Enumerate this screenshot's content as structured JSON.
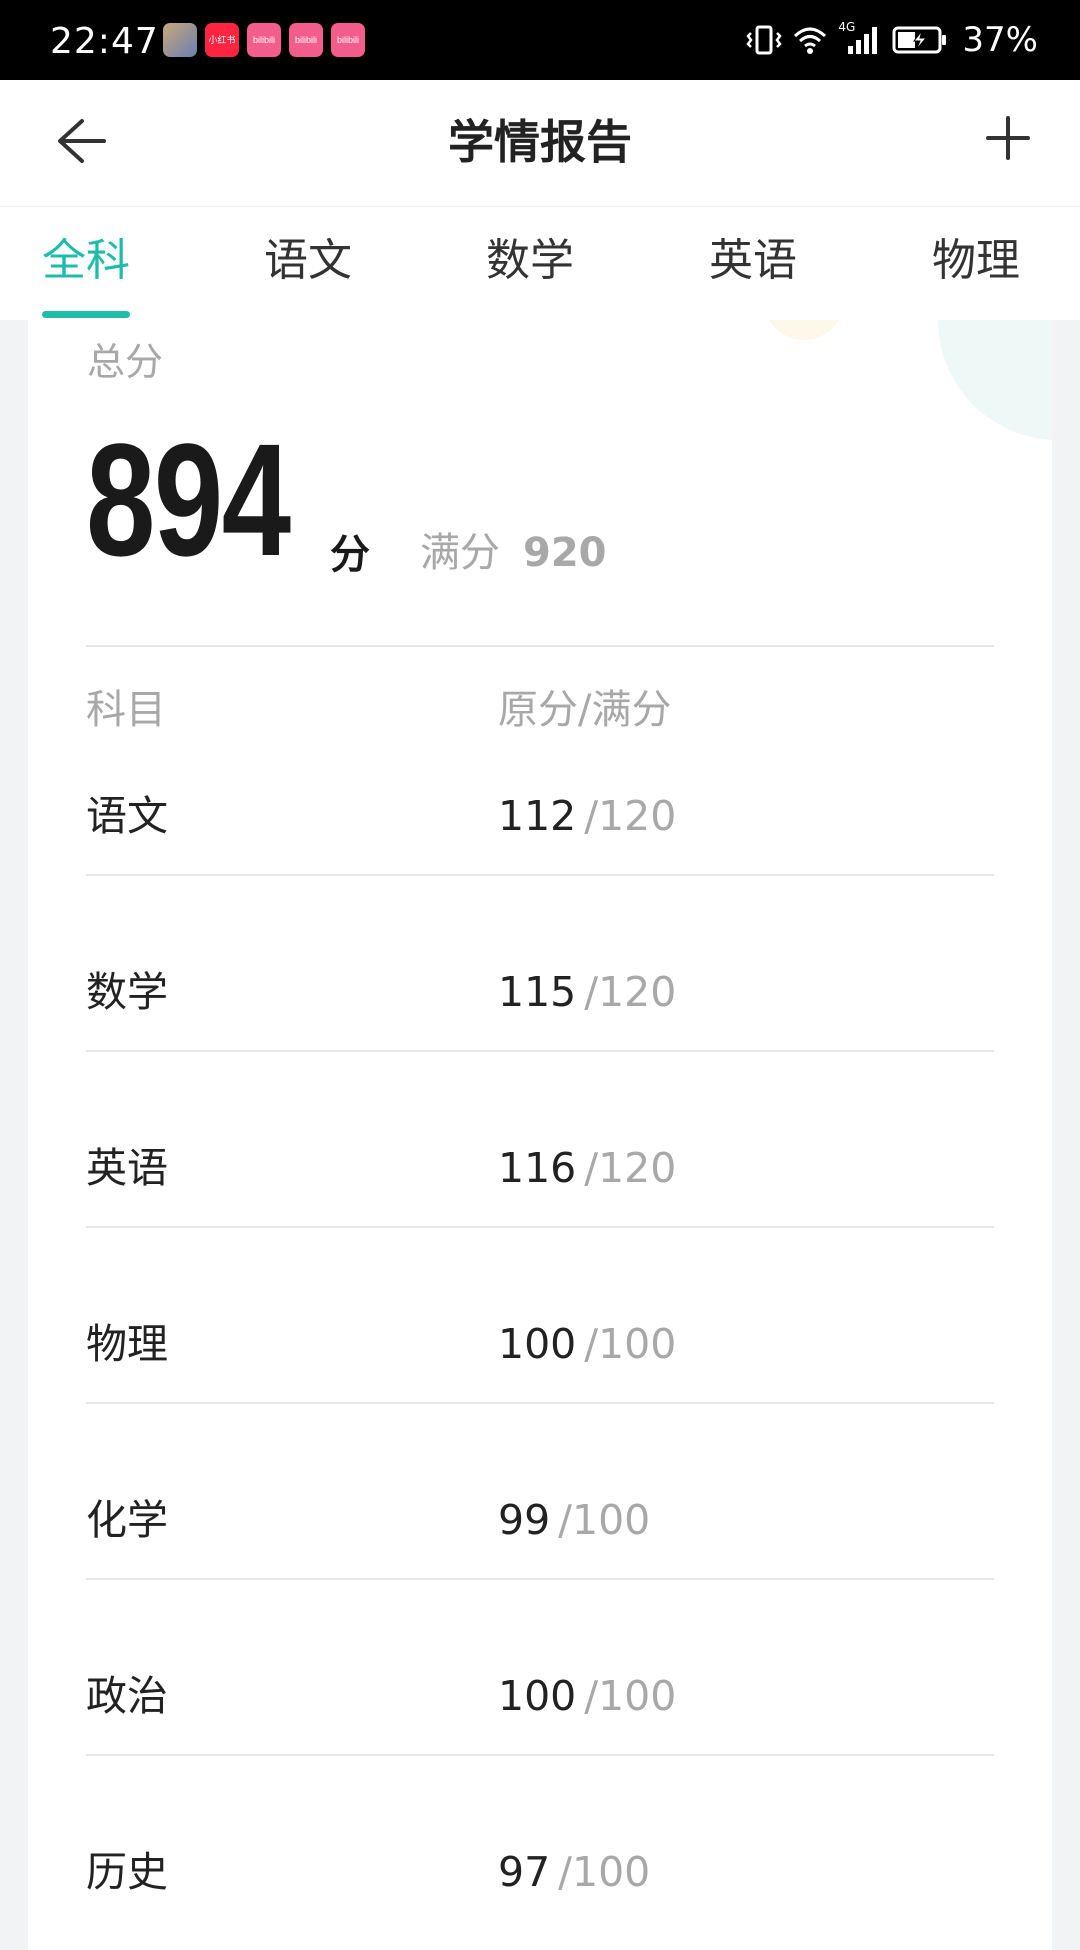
{
  "status_bar": {
    "time": "22:47",
    "battery_percent": "37%",
    "network_label": "4G",
    "notification_icons": [
      {
        "name": "game-avatar-icon",
        "label": ""
      },
      {
        "name": "xiaohongshu-icon",
        "label": "小红书"
      },
      {
        "name": "bilibili-icon",
        "label": "bilibili"
      },
      {
        "name": "bilibili-icon",
        "label": "bilibili"
      },
      {
        "name": "bilibili-icon",
        "label": "bilibili"
      }
    ]
  },
  "header": {
    "title": "学情报告",
    "back_icon": "arrow-left-icon",
    "add_icon": "plus-icon"
  },
  "tabs": [
    {
      "label": "全科",
      "active": true
    },
    {
      "label": "语文",
      "active": false
    },
    {
      "label": "数学",
      "active": false
    },
    {
      "label": "英语",
      "active": false
    },
    {
      "label": "物理",
      "active": false
    }
  ],
  "summary": {
    "total_label": "总分",
    "total_score": "894",
    "total_unit": "分",
    "full_mark_label": "满分",
    "full_mark_value": "920"
  },
  "table": {
    "header_subject": "科目",
    "header_score": "原分/满分",
    "rows": [
      {
        "subject": "语文",
        "raw": "112",
        "full": "/120"
      },
      {
        "subject": "数学",
        "raw": "115",
        "full": "/120"
      },
      {
        "subject": "英语",
        "raw": "116",
        "full": "/120"
      },
      {
        "subject": "物理",
        "raw": "100",
        "full": "/100"
      },
      {
        "subject": "化学",
        "raw": "99",
        "full": "/100"
      },
      {
        "subject": "政治",
        "raw": "100",
        "full": "/100"
      },
      {
        "subject": "历史",
        "raw": "97",
        "full": "/100"
      }
    ]
  },
  "colors": {
    "accent": "#1fbcab",
    "text_primary": "#222222",
    "text_secondary": "#a8a8a8",
    "page_background": "#f2f3f5"
  }
}
